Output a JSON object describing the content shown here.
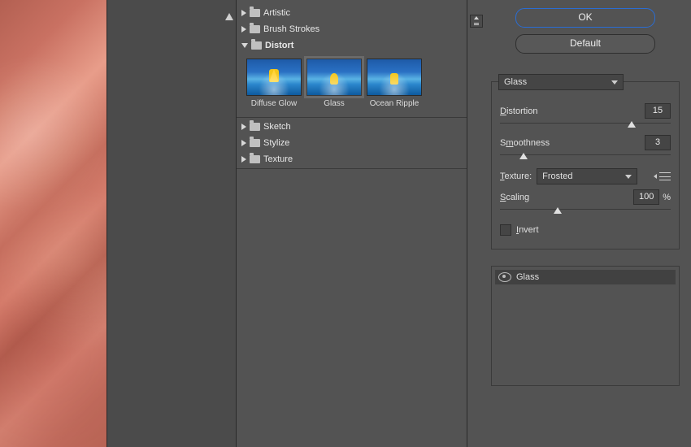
{
  "categories": [
    {
      "label": "Artistic",
      "expanded": false
    },
    {
      "label": "Brush Strokes",
      "expanded": false
    },
    {
      "label": "Distort",
      "expanded": true
    },
    {
      "label": "Sketch",
      "expanded": false
    },
    {
      "label": "Stylize",
      "expanded": false
    },
    {
      "label": "Texture",
      "expanded": false
    }
  ],
  "distort_filters": [
    {
      "name": "Diffuse Glow",
      "selected": false
    },
    {
      "name": "Glass",
      "selected": true
    },
    {
      "name": "Ocean Ripple",
      "selected": false
    }
  ],
  "buttons": {
    "ok": "OK",
    "default": "Default"
  },
  "filter_select": {
    "value": "Glass"
  },
  "params": {
    "distortion": {
      "label": "Distortion",
      "value": "15",
      "pos": 77
    },
    "smoothness": {
      "label": "Smoothness",
      "value": "3",
      "pos": 14
    },
    "texture": {
      "label": "Texture:",
      "value": "Frosted"
    },
    "scaling": {
      "label": "Scaling",
      "value": "100",
      "pos": 34,
      "unit": "%"
    },
    "invert": {
      "label": "Invert",
      "checked": false
    }
  },
  "layer": {
    "name": "Glass",
    "visible": true
  }
}
